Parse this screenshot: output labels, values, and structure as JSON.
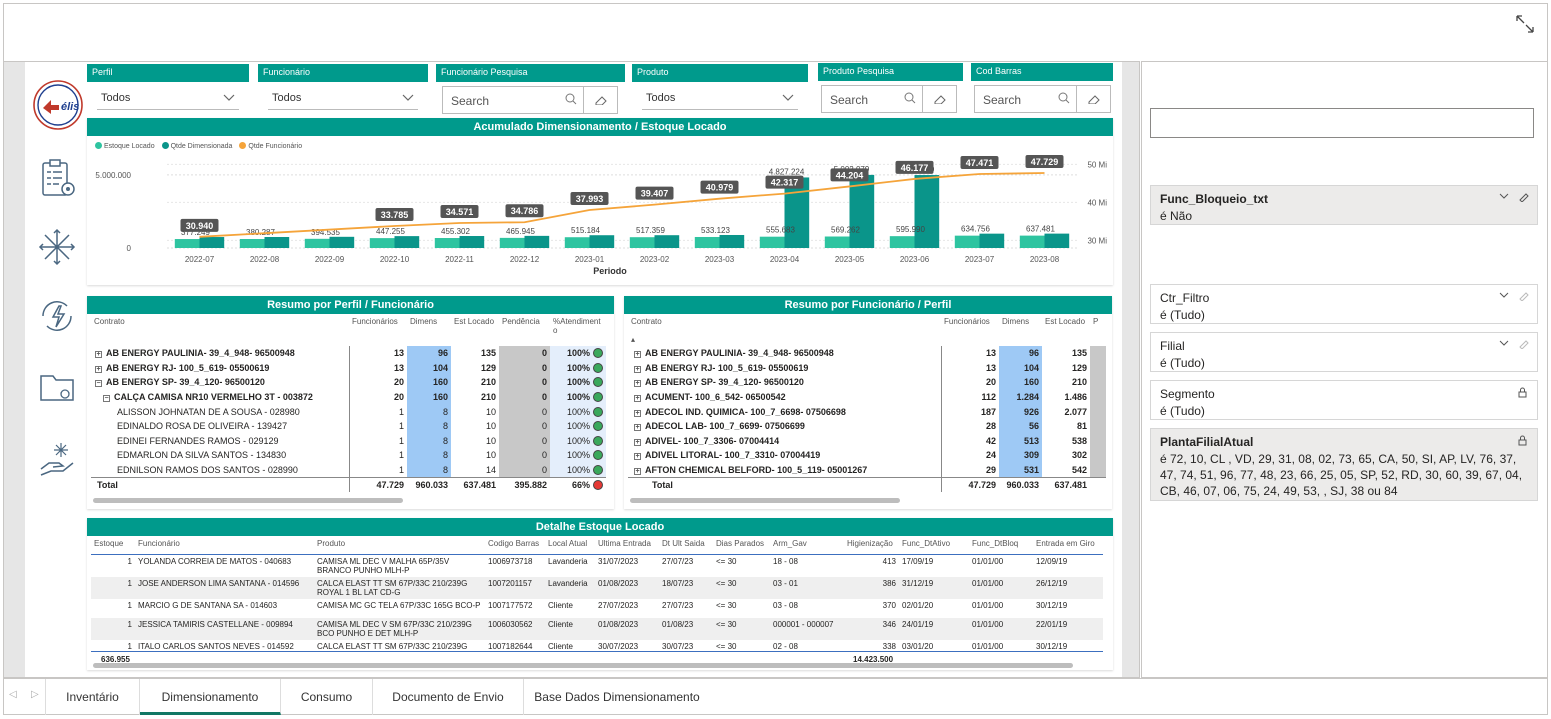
{
  "slicers": [
    {
      "label": "Perfil",
      "value": "Todos"
    },
    {
      "label": "Funcionário",
      "value": "Todos"
    },
    {
      "label": "Funcionário Pesquisa",
      "placeholder": "Search"
    },
    {
      "label": "Produto",
      "value": "Todos"
    },
    {
      "label": "Produto Pesquisa",
      "placeholder": "Search"
    },
    {
      "label": "Cod Barras",
      "placeholder": "Search"
    }
  ],
  "logo_text": "élis",
  "chart": {
    "title": "Acumulado Dimensionamento / Estoque Locado"
  },
  "chart_data": {
    "type": "bar",
    "title": "Acumulado Dimensionamento / Estoque Locado",
    "xlabel": "Periodo",
    "categories": [
      "2022-07",
      "2022-08",
      "2022-09",
      "2022-10",
      "2022-11",
      "2022-12",
      "2023-01",
      "2023-02",
      "2023-03",
      "2023-04",
      "2023-05",
      "2023-06",
      "2023-07",
      "2023-08"
    ],
    "series": [
      {
        "name": "Estoque Locado",
        "color": "#2ec4a0",
        "values": [
          377249,
          380287,
          394535,
          447255,
          455302,
          465945,
          515184,
          517359,
          533123,
          555683,
          569262,
          595990,
          634756,
          637481
        ],
        "labels": [
          "377.249",
          "380.287",
          "394.535",
          "447.255",
          "455.302",
          "465.945",
          "515.184",
          "517.359",
          "533.123",
          "555.683",
          "569.262",
          "595.990",
          "634.756",
          "637.481"
        ]
      },
      {
        "name": "Qtde Dimensionada",
        "color": "#0a958a",
        "values": [
          377249,
          380287,
          394535,
          447255,
          455302,
          465945,
          515184,
          517359,
          533123,
          4827224,
          5002079,
          4991410,
          634756,
          637481
        ],
        "labels": [
          "",
          "",
          "",
          "",
          "",
          "",
          "",
          "",
          "",
          "4.827.224",
          "5.002.079",
          "4.991.410",
          "",
          ""
        ]
      },
      {
        "name": "Qtde Funcionário",
        "color": "#f5a43a",
        "values": [
          30940,
          null,
          null,
          33785,
          34571,
          34786,
          37993,
          39407,
          40979,
          42317,
          44204,
          46177,
          47471,
          47729
        ],
        "labels": [
          "30.940",
          "",
          "",
          "33.785",
          "34.571",
          "34.786",
          "37.993",
          "39.407",
          "40.979",
          "42.317",
          "44.204",
          "46.177",
          "47.471",
          "47.729"
        ]
      }
    ],
    "y_left": {
      "ticks": [
        "0",
        "5.000.000"
      ],
      "range": [
        0,
        6500000
      ]
    },
    "y_right": {
      "ticks": [
        "30 Mi",
        "40 Mi",
        "50 Mi"
      ],
      "range": [
        28000,
        53000
      ]
    },
    "legend": "top-left"
  },
  "perfil": {
    "title": "Resumo por Perfil / Funcionário",
    "headers": [
      "Contrato",
      "Funcionários",
      "Dimens",
      "Est Locado",
      "Pendência",
      "%Atendimento"
    ],
    "rows": [
      {
        "name": "AB ENERGY PAULINIA- 39_4_948- 96500948",
        "level": 0,
        "sign": "+",
        "bold": true,
        "f": "13",
        "d": "96",
        "e": "135",
        "p": "0",
        "pct": "100%",
        "status": "#3aa85c"
      },
      {
        "name": "AB ENERGY RJ- 100_5_619- 05500619",
        "level": 0,
        "sign": "+",
        "bold": true,
        "f": "13",
        "d": "104",
        "e": "129",
        "p": "0",
        "pct": "100%",
        "status": "#3aa85c"
      },
      {
        "name": "AB ENERGY SP- 39_4_120- 96500120",
        "level": 0,
        "sign": "−",
        "bold": true,
        "f": "20",
        "d": "160",
        "e": "210",
        "p": "0",
        "pct": "100%",
        "status": "#3aa85c"
      },
      {
        "name": "CALÇA CAMISA NR10 VERMELHO 3T - 003872",
        "level": 1,
        "sign": "−",
        "bold": true,
        "f": "20",
        "d": "160",
        "e": "210",
        "p": "0",
        "pct": "100%",
        "status": "#3aa85c"
      },
      {
        "name": "ALISSON JOHNATAN DE A SOUSA - 028980",
        "level": 2,
        "sign": "",
        "bold": false,
        "f": "1",
        "d": "8",
        "e": "10",
        "p": "0",
        "pct": "100%",
        "status": "#3aa85c"
      },
      {
        "name": "EDINALDO ROSA DE OLIVEIRA - 139427",
        "level": 2,
        "sign": "",
        "bold": false,
        "f": "1",
        "d": "8",
        "e": "10",
        "p": "0",
        "pct": "100%",
        "status": "#3aa85c"
      },
      {
        "name": "EDINEI FERNANDES RAMOS - 029129",
        "level": 2,
        "sign": "",
        "bold": false,
        "f": "1",
        "d": "8",
        "e": "10",
        "p": "0",
        "pct": "100%",
        "status": "#3aa85c"
      },
      {
        "name": "EDMARLON DA SILVA SANTOS - 134830",
        "level": 2,
        "sign": "",
        "bold": false,
        "f": "1",
        "d": "8",
        "e": "10",
        "p": "0",
        "pct": "100%",
        "status": "#3aa85c"
      },
      {
        "name": "EDNILSON RAMOS DOS SANTOS - 028990",
        "level": 2,
        "sign": "",
        "bold": false,
        "f": "1",
        "d": "8",
        "e": "14",
        "p": "0",
        "pct": "100%",
        "status": "#3aa85c"
      }
    ],
    "total": {
      "name": "Total",
      "f": "47.729",
      "d": "960.033",
      "e": "637.481",
      "p": "395.882",
      "pct": "66%",
      "status": "#e53935"
    }
  },
  "funcionario": {
    "title": "Resumo por Funcionário / Perfil",
    "headers": [
      "Contrato",
      "Funcionários",
      "Dimens",
      "Est Locado",
      "P"
    ],
    "rows": [
      {
        "name": "AB ENERGY PAULINIA- 39_4_948- 96500948",
        "f": "13",
        "d": "96",
        "e": "135"
      },
      {
        "name": "AB ENERGY RJ- 100_5_619- 05500619",
        "f": "13",
        "d": "104",
        "e": "129"
      },
      {
        "name": "AB ENERGY SP- 39_4_120- 96500120",
        "f": "20",
        "d": "160",
        "e": "210"
      },
      {
        "name": "ACUMENT- 100_6_542- 06500542",
        "f": "112",
        "d": "1.284",
        "e": "1.486"
      },
      {
        "name": "ADECOL IND. QUIMICA- 100_7_6698- 07506698",
        "f": "187",
        "d": "926",
        "e": "2.077"
      },
      {
        "name": "ADECOL LAB- 100_7_6699- 07506699",
        "f": "28",
        "d": "56",
        "e": "81"
      },
      {
        "name": "ADIVEL- 100_7_3306- 07004414",
        "f": "42",
        "d": "513",
        "e": "538"
      },
      {
        "name": "ADIVEL LITORAL- 100_7_3310- 07004419",
        "f": "24",
        "d": "309",
        "e": "302"
      },
      {
        "name": "AFTON CHEMICAL BELFORD- 100_5_119- 05001267",
        "f": "29",
        "d": "531",
        "e": "542"
      }
    ],
    "total": {
      "name": "Total",
      "f": "47.729",
      "d": "960.033",
      "e": "637.481"
    }
  },
  "detalhe": {
    "title": "Detalhe Estoque Locado",
    "headers": [
      "Estoque",
      "Funcionário",
      "Produto",
      "Codigo Barras",
      "Local Atual",
      "Ultima Entrada",
      "Dt Ult Saida",
      "Dias Parados",
      "Arm_Gav",
      "Higienização",
      "Func_DtAtivo",
      "Func_DtBloq",
      "Entrada em Giro"
    ],
    "rows": [
      [
        "1",
        "YOLANDA CORREIA DE MATOS - 040683",
        "CAMISA ML DEC V MALHA 65P/35V BRANCO PUNHO MLH-P",
        "1006973718",
        "Lavanderia",
        "31/07/2023",
        "27/07/23",
        "<= 30",
        "18 - 08",
        "413",
        "17/09/19",
        "01/01/00",
        "12/09/19"
      ],
      [
        "1",
        "JOSE ANDERSON LIMA SANTANA - 014596",
        "CALCA ELAST TT SM 67P/33C 210/239G ROYAL 1 BL LAT CD-G",
        "1007201157",
        "Lavanderia",
        "01/08/2023",
        "18/07/23",
        "<= 30",
        "03 - 01",
        "386",
        "31/12/19",
        "01/01/00",
        "26/12/19"
      ],
      [
        "1",
        "MARCIO G DE SANTANA SA - 014603",
        "CAMISA MC GC TELA 67P/33C 165G BCO-P",
        "1007177572",
        "Cliente",
        "27/07/2023",
        "27/07/23",
        "<= 30",
        "03 - 08",
        "370",
        "02/01/20",
        "01/01/00",
        "30/12/19"
      ],
      [
        "1",
        "JESSICA TAMIRIS CASTELLANE - 009894",
        "CAMISA ML DEC V SM 67P/33C 210/239G BCO PUNHO E DET MLH-P",
        "1006030562",
        "Cliente",
        "01/08/2023",
        "01/08/23",
        "<= 30",
        "000001 - 000007",
        "346",
        "24/01/19",
        "01/01/00",
        "22/01/19"
      ],
      [
        "1",
        "ITALO CARLOS SANTOS NEVES - 014592",
        "CALCA ELAST TT SM 67P/33C 210/239G",
        "1007182644",
        "Cliente",
        "30/07/2023",
        "30/07/23",
        "<= 30",
        "02 - 08",
        "338",
        "03/01/20",
        "01/01/00",
        "30/12/19"
      ]
    ],
    "total_estoque": "636.955",
    "total_hig": "14.423.500"
  },
  "tabs": [
    "Inventário",
    "Dimensionamento",
    "Consumo",
    "Documento de Envio",
    "Base Dados Dimensionamento"
  ],
  "active_tab": "Dimensionamento",
  "filters": [
    {
      "name": "Func_Bloqueio_txt",
      "value": "é Não",
      "bold": true,
      "applied": true
    },
    {
      "name": "Ctr_Filtro",
      "value": "é (Tudo)",
      "bold": false,
      "applied": false
    },
    {
      "name": "Filial",
      "value": "é (Tudo)",
      "bold": false,
      "applied": false
    },
    {
      "name": "Segmento",
      "value": "é (Tudo)",
      "bold": false,
      "applied": false,
      "locked": true
    },
    {
      "name": "PlantaFilialAtual",
      "value": "é 72, 10, CL , VD, 29, 31, 08, 02, 73, 65, CA, 50, SI, AP, LV, 76, 37, 47, 74, 51, 96, 77, 48, 23, 66, 25, 05, SP, 52, RD, 30, 60, 39, 67, 04, CB, 46, 07, 06, 75, 24, 49, 53, , SJ, 38 ou 84",
      "bold": true,
      "applied": true,
      "locked": true
    }
  ],
  "colors": {
    "teal": "#009a8c",
    "tab_accent": "#117865"
  }
}
